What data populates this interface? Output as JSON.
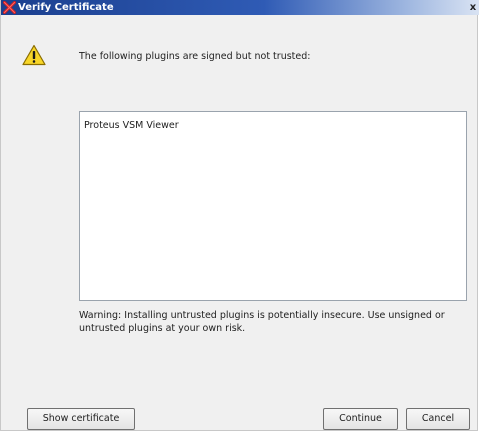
{
  "window": {
    "title": "Verify Certificate",
    "close_glyph": "x",
    "title_icon": "red-x-icon"
  },
  "content": {
    "icon": "warning-triangle-icon",
    "header": "The following plugins are signed but not trusted:",
    "plugins": [
      "Proteus VSM Viewer"
    ],
    "warning": "Warning: Installing untrusted plugins is potentially insecure. Use unsigned or untrusted plugins at your own risk."
  },
  "buttons": {
    "show_certificate": "Show certificate",
    "continue": "Continue",
    "cancel": "Cancel"
  },
  "colors": {
    "titlebar_start": "#1b3f8e",
    "titlebar_end": "#d9e3f3",
    "dialog_bg": "#f0f0f0",
    "warning_yellow": "#f8d628"
  }
}
